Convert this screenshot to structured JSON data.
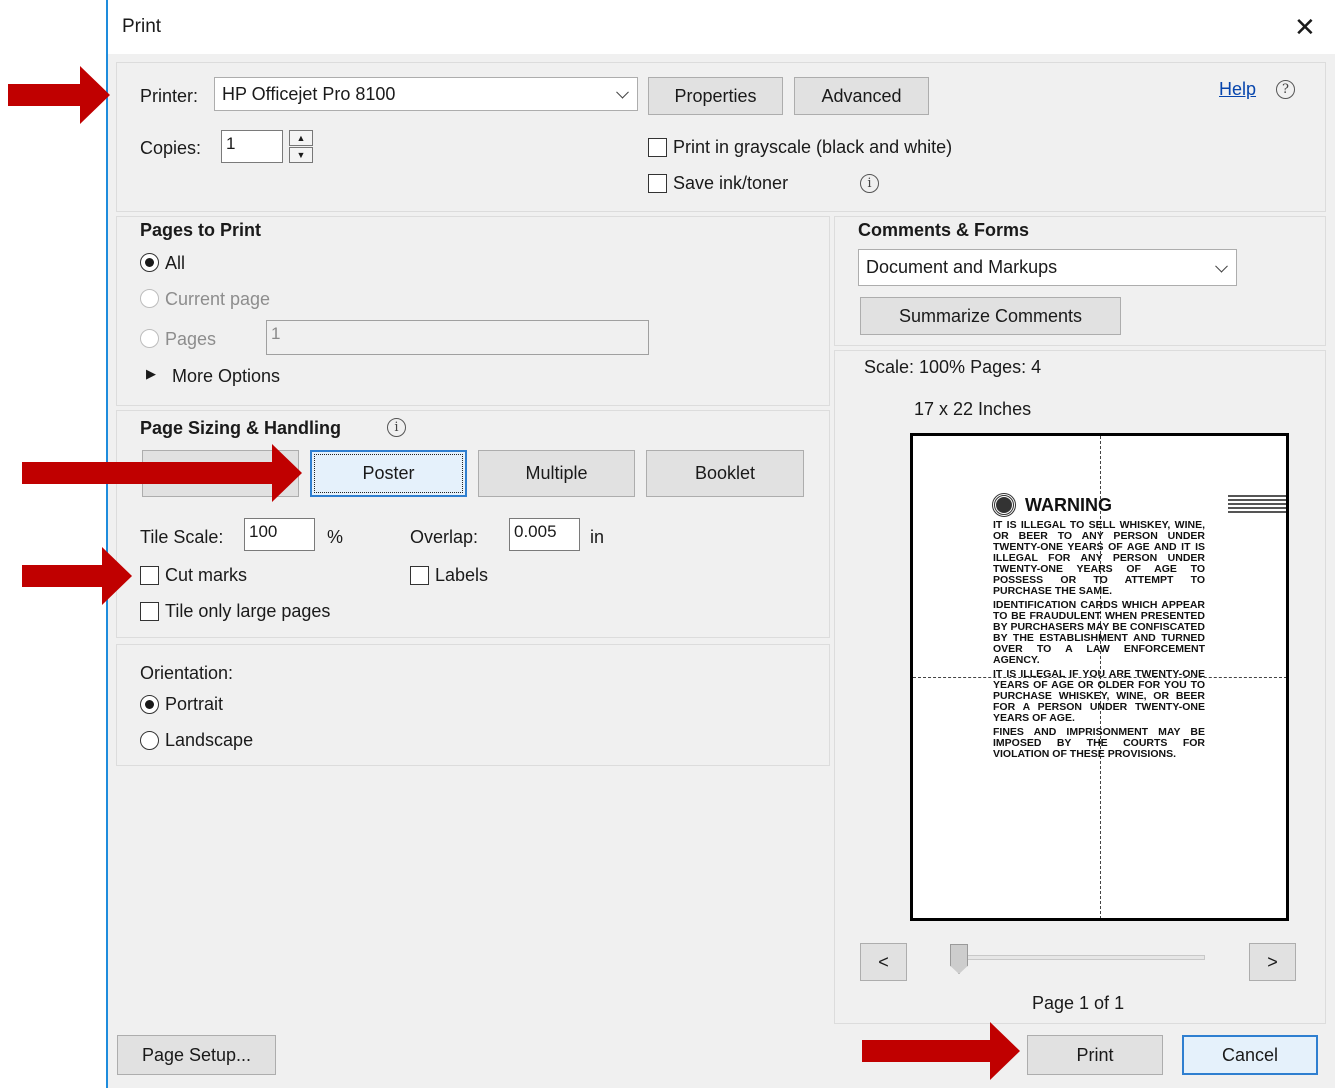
{
  "window": {
    "title": "Print"
  },
  "printer": {
    "label": "Printer:",
    "selected": "HP Officejet Pro 8100",
    "properties_label": "Properties",
    "advanced_label": "Advanced",
    "help_label": "Help",
    "copies_label": "Copies:",
    "copies_value": "1",
    "grayscale_label": "Print in grayscale (black and white)",
    "save_ink_label": "Save ink/toner"
  },
  "pages_to_print": {
    "heading": "Pages to Print",
    "all_label": "All",
    "current_label": "Current page",
    "pages_label": "Pages",
    "pages_value": "1",
    "more_options_label": "More Options"
  },
  "sizing": {
    "heading": "Page Sizing & Handling",
    "buttons": [
      "",
      "Poster",
      "Multiple",
      "Booklet"
    ],
    "tile_scale_label": "Tile Scale:",
    "tile_scale_value": "100",
    "tile_scale_unit": "%",
    "overlap_label": "Overlap:",
    "overlap_value": "0.005",
    "overlap_unit": "in",
    "cut_marks_label": "Cut marks",
    "labels_label": "Labels",
    "tile_large_label": "Tile only large pages"
  },
  "orientation": {
    "heading": "Orientation:",
    "portrait_label": "Portrait",
    "landscape_label": "Landscape"
  },
  "comments_forms": {
    "heading": "Comments & Forms",
    "selected": "Document and Markups",
    "summarize_label": "Summarize Comments"
  },
  "preview": {
    "scale_text": "Scale: 100% Pages: 4",
    "size_text": "17 x 22 Inches",
    "prev_label": "<",
    "next_label": ">",
    "page_text": "Page 1 of 1",
    "doc": {
      "title": "WARNING",
      "p1": "IT IS ILLEGAL TO SELL WHISKEY, WINE, OR BEER TO ANY PERSON UNDER TWENTY-ONE YEARS OF AGE AND IT IS ILLEGAL FOR ANY PERSON UNDER TWENTY-ONE YEARS OF AGE TO POSSESS OR TO ATTEMPT TO PURCHASE THE SAME.",
      "p2": "IDENTIFICATION CARDS WHICH APPEAR TO BE FRAUDULENT WHEN PRESENTED BY PURCHASERS MAY BE CONFISCATED BY THE ESTABLISHMENT AND TURNED OVER TO A LAW ENFORCEMENT AGENCY.",
      "p3": "IT IS ILLEGAL IF YOU ARE TWENTY-ONE YEARS OF AGE OR OLDER FOR YOU TO PURCHASE WHISKEY, WINE, OR BEER FOR A PERSON UNDER TWENTY-ONE YEARS OF AGE.",
      "p4": "FINES AND IMPRISONMENT MAY BE IMPOSED BY THE COURTS FOR VIOLATION OF THESE PROVISIONS."
    }
  },
  "footer": {
    "page_setup_label": "Page Setup...",
    "print_label": "Print",
    "cancel_label": "Cancel"
  },
  "colors": {
    "accent": "#1e8cdc",
    "annotation_arrow": "#c00000",
    "link": "#0645ad"
  }
}
